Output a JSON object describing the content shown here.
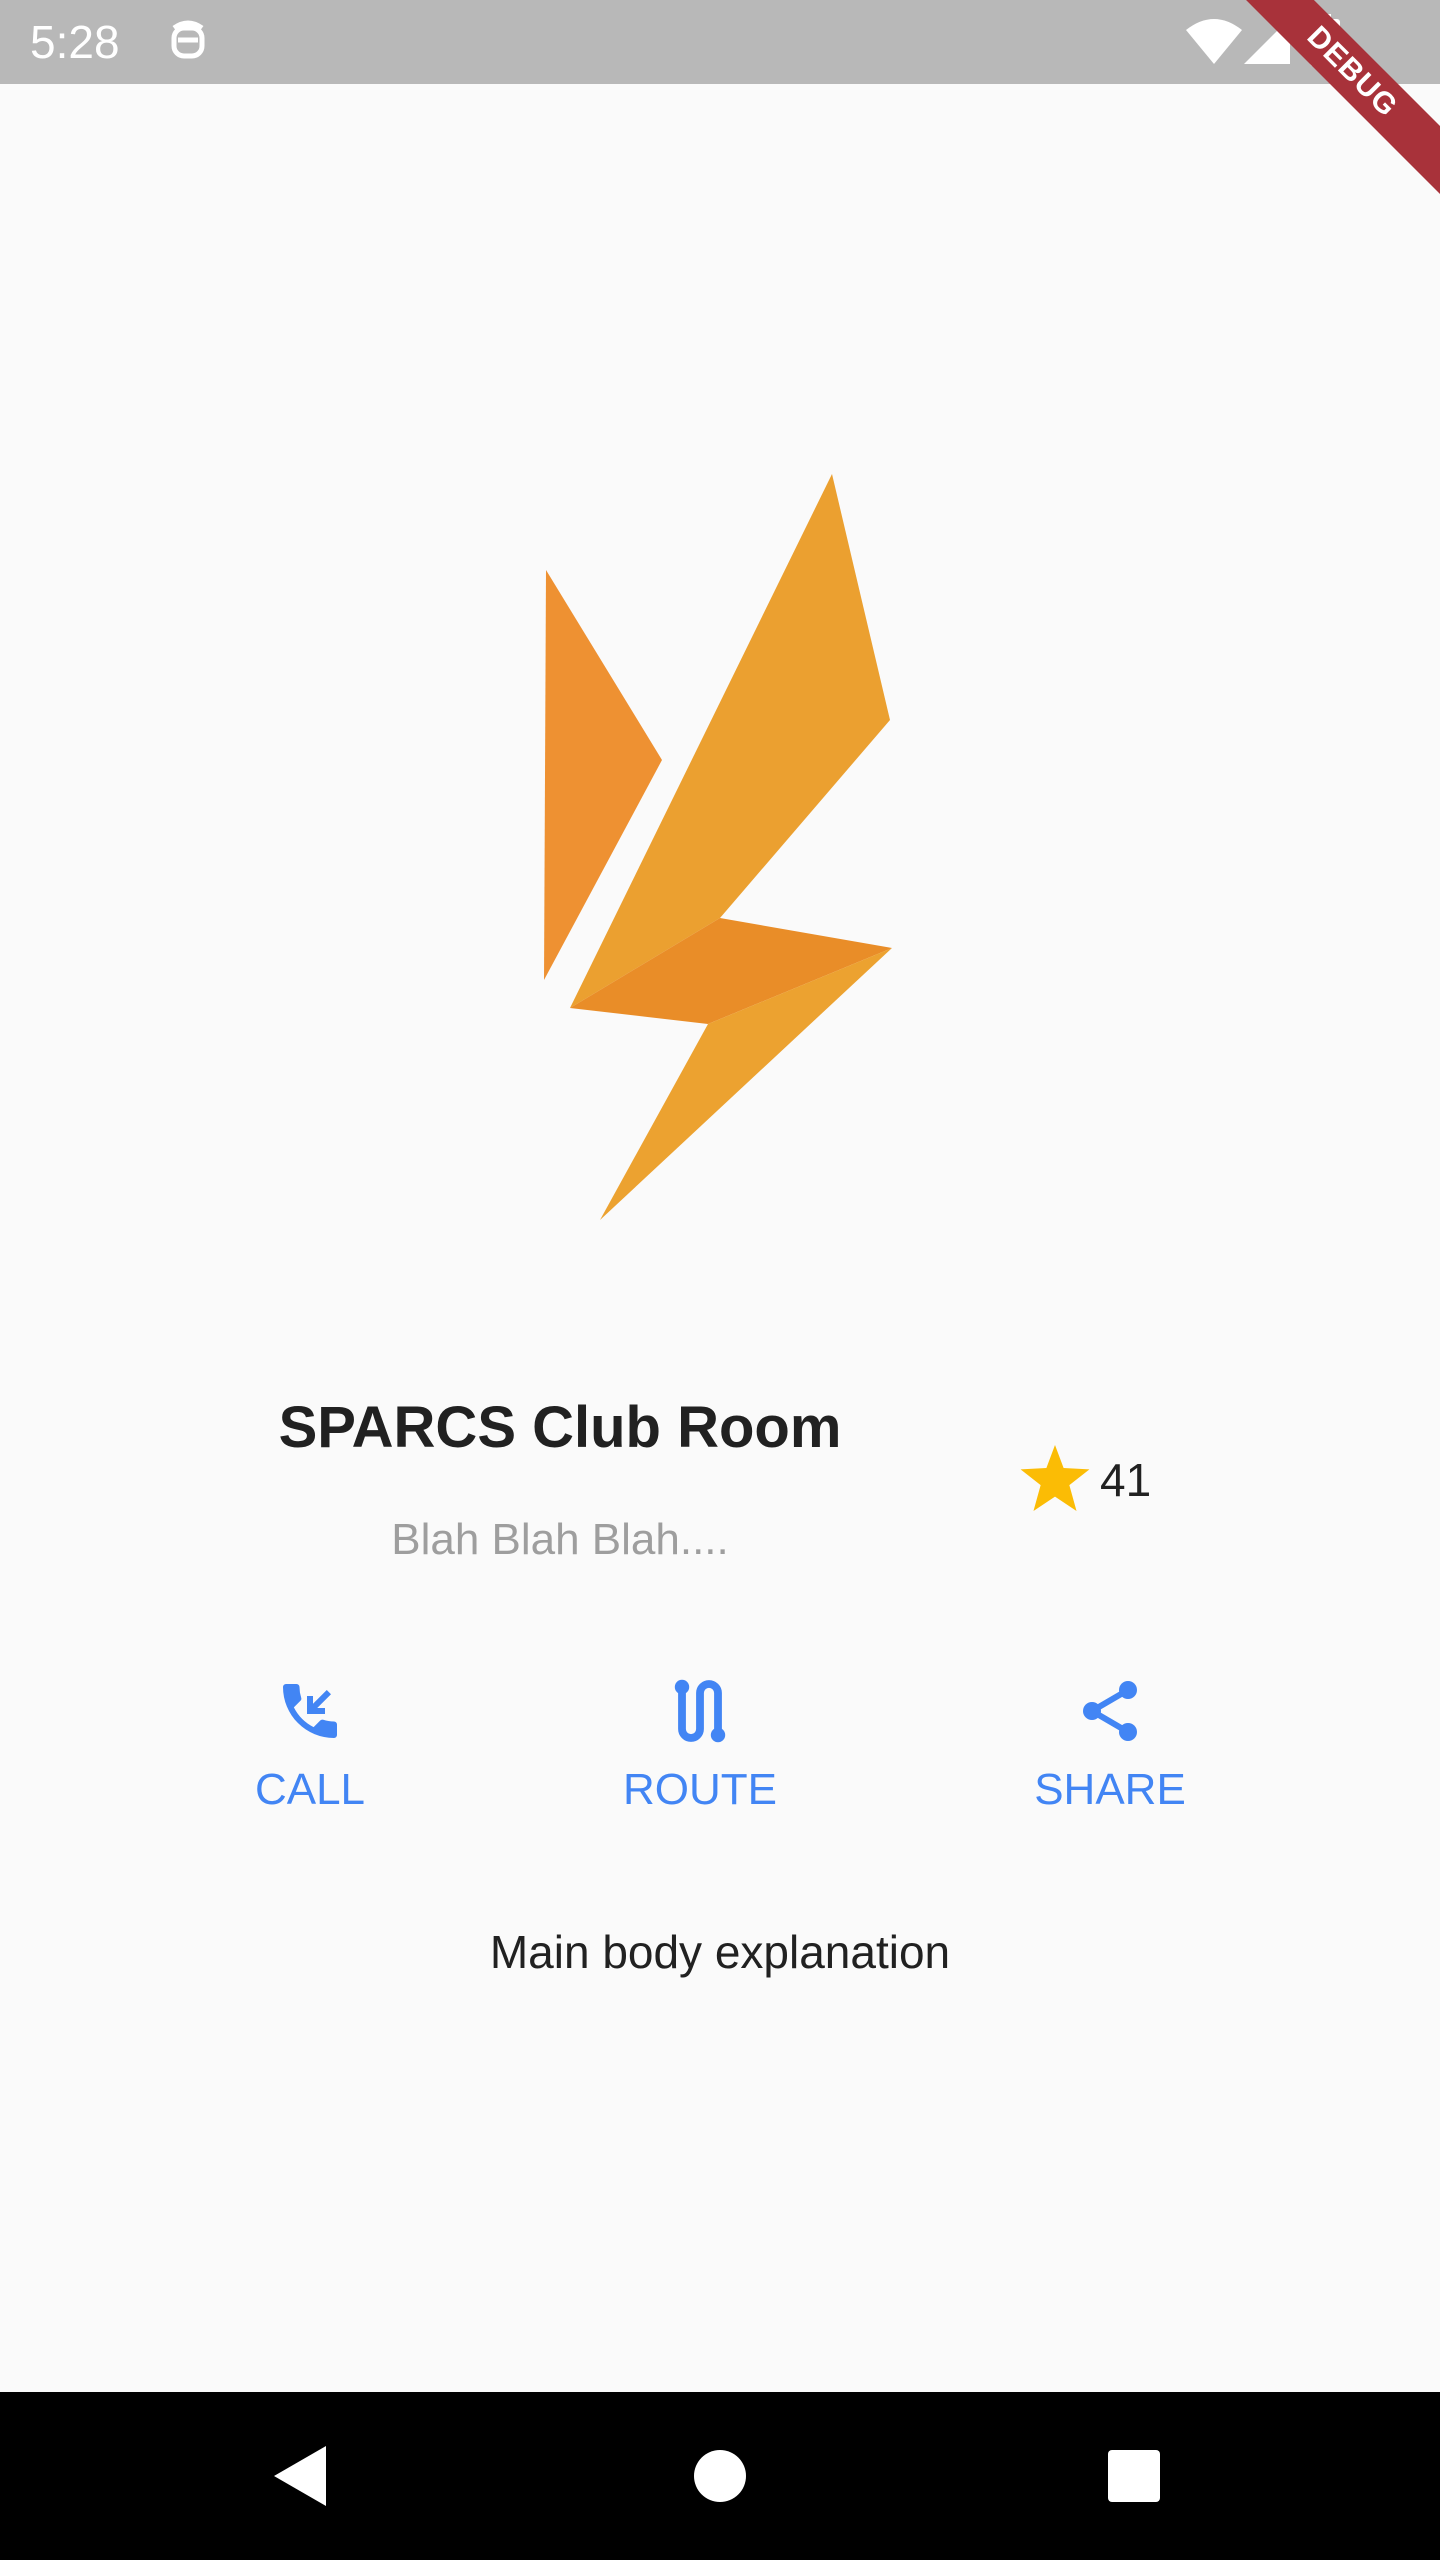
{
  "status_bar": {
    "time": "5:28",
    "icons": [
      "notification-app-icon",
      "wifi-icon",
      "signal-icon",
      "battery-icon"
    ]
  },
  "debug_banner": {
    "label": "DEBUG"
  },
  "logo": {
    "name": "sparcs-logo",
    "colors": [
      "#ee9932",
      "#e98f28",
      "#eba030"
    ]
  },
  "place": {
    "title": "SPARCS Club Room",
    "subtitle": "Blah Blah Blah....",
    "rating_count": "41",
    "rating_icon": "star-icon",
    "rating_color": "#fbbc05"
  },
  "actions": [
    {
      "label": "CALL",
      "icon": "phone-icon"
    },
    {
      "label": "ROUTE",
      "icon": "route-icon"
    },
    {
      "label": "SHARE",
      "icon": "share-icon"
    }
  ],
  "accent_color": "#4285f4",
  "body": {
    "text": "Main body explanation"
  },
  "nav_bar": {
    "buttons": [
      "back-icon",
      "home-icon",
      "recents-icon"
    ]
  }
}
